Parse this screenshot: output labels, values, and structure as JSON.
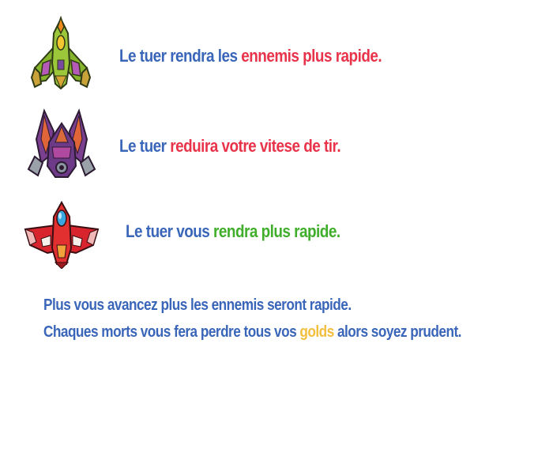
{
  "rows": [
    {
      "icon": "green-fighter-ship-icon",
      "prefix": "Le tuer rendra les ",
      "highlight": "ennemis plus rapide.",
      "suffix": "",
      "highlight_color": "#e8334a"
    },
    {
      "icon": "purple-winged-ship-icon",
      "prefix": "Le tuer ",
      "highlight": "reduira votre vitese de tir.",
      "suffix": "",
      "highlight_color": "#e8334a"
    },
    {
      "icon": "red-jet-ship-icon",
      "prefix": "Le tuer vous ",
      "highlight": "rendra plus rapide.",
      "suffix": "",
      "highlight_color": "#3fae2a"
    }
  ],
  "footer": {
    "line1": "Plus vous avancez plus les ennemis seront rapide.",
    "line2_prefix": "Chaques morts vous fera perdre tous vos ",
    "line2_highlight": "golds",
    "line2_suffix": " alors soyez prudent."
  },
  "colors": {
    "text": "#3a66b9",
    "red": "#e8334a",
    "green": "#3fae2a",
    "gold": "#f2be3c"
  }
}
